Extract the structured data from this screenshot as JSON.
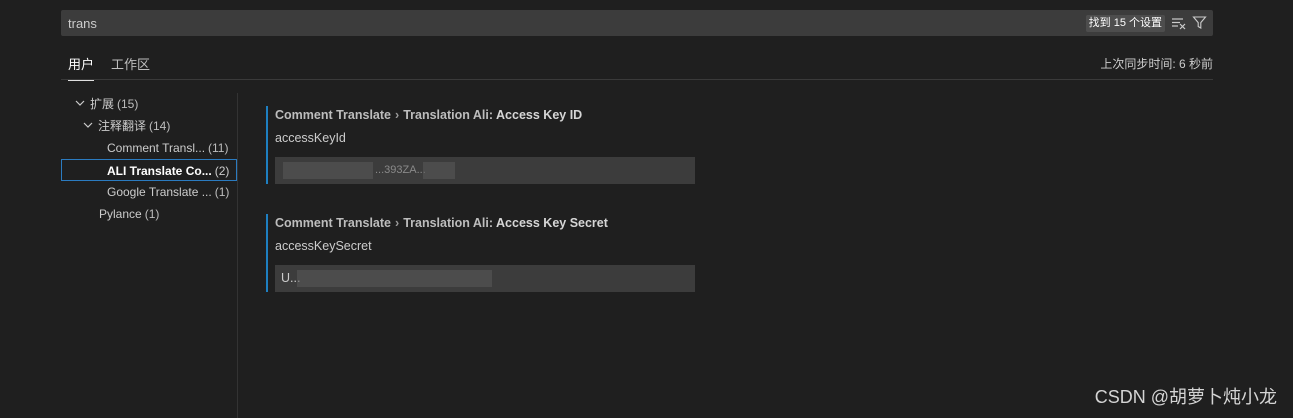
{
  "search": {
    "value": "trans",
    "result_count": "找到 15 个设置",
    "icons": [
      "clear-filter-icon",
      "filter-icon"
    ]
  },
  "tabs": [
    {
      "label": "用户",
      "active": true
    },
    {
      "label": "工作区",
      "active": false
    }
  ],
  "sync_status": "上次同步时间: 6 秒前",
  "tree": {
    "extensions": {
      "label": "扩展",
      "count": "(15)"
    },
    "comment_translate_group": {
      "label": "注释翻译",
      "count": "(14)"
    },
    "comment_translate": {
      "label": "Comment Transl...",
      "count": "(11)"
    },
    "ali_translate": {
      "label": "ALI Translate Co...",
      "count": "(2)"
    },
    "google_translate": {
      "label": "Google Translate ...",
      "count": "(1)"
    },
    "pylance": {
      "label": "Pylance",
      "count": "(1)"
    }
  },
  "settings": [
    {
      "category": "Comment Translate",
      "separator": "›",
      "prefix": "Translation Ali:",
      "name": "Access Key ID",
      "description": "accessKeyId",
      "value_visible": "...393ZA..."
    },
    {
      "category": "Comment Translate",
      "separator": "›",
      "prefix": "Translation Ali:",
      "name": "Access Key Secret",
      "description": "accessKeySecret",
      "value_visible": "U..."
    }
  ],
  "watermark": "CSDN @胡萝卜炖小龙",
  "colors": {
    "background": "#1f1f1f",
    "accent": "#1e7fc1",
    "input_bg": "#3c3c3c"
  }
}
